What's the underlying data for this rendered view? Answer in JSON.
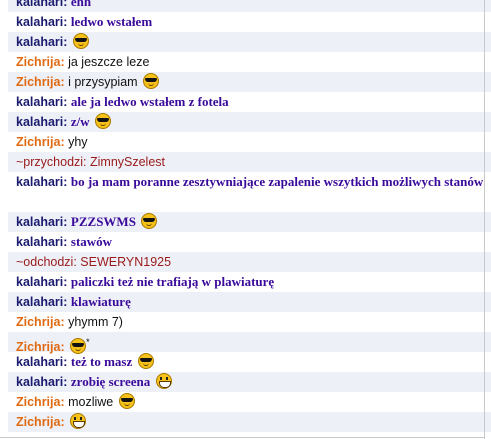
{
  "messages": [
    {
      "nick": "kalahari:",
      "text": "ehh"
    },
    {
      "nick": "kalahari:",
      "text": "ledwo wstałem"
    },
    {
      "nick": "kalahari:",
      "text": ""
    },
    {
      "nick": "Zichrija:",
      "text": "ja jeszcze leze"
    },
    {
      "nick": "Zichrija:",
      "text": "i przysypiam"
    },
    {
      "nick": "kalahari:",
      "text": "ale ja ledwo wstałem z fotela"
    },
    {
      "nick": "kalahari:",
      "text": "z/w"
    },
    {
      "nick": "Zichrija:",
      "text": "yhy"
    },
    {
      "system": "~przychodzi: ZimnySzelest"
    },
    {
      "nick": "kalahari:",
      "text": "bo ja mam poranne zesztywniające zapalenie wszytkich możliwych stanów"
    },
    {
      "nick": "kalahari:",
      "text": "PZZSWMS"
    },
    {
      "nick": "kalahari:",
      "text": "stawów"
    },
    {
      "system": "~odchodzi: SEWERYN1925"
    },
    {
      "nick": "kalahari:",
      "text": "paliczki też nie trafiają w plawiaturę"
    },
    {
      "nick": "kalahari:",
      "text": "klawiaturę"
    },
    {
      "nick": "Zichrija:",
      "text": "yhymm 7)"
    },
    {
      "nick": "Zichrija:",
      "text": "",
      "suffix": "*"
    },
    {
      "nick": "kalahari:",
      "text": "też to masz"
    },
    {
      "nick": "kalahari:",
      "text": "zrobię screena"
    },
    {
      "nick": "Zichrija:",
      "text": "mozliwe"
    },
    {
      "nick": "Zichrija:",
      "text": ""
    }
  ],
  "emoticons": [
    "cool-smiley-icon",
    "grin-smiley-icon"
  ]
}
